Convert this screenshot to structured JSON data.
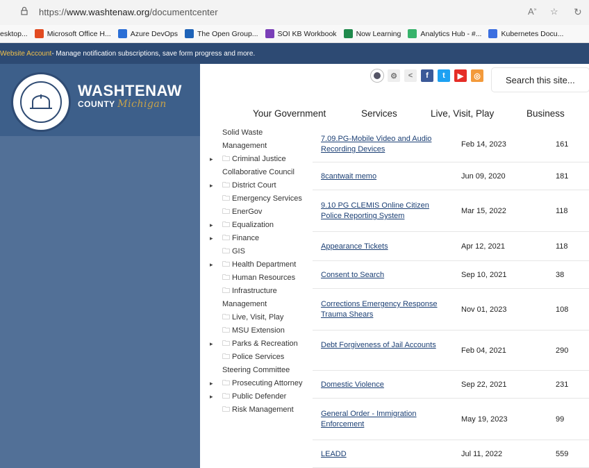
{
  "browser": {
    "url_prefix": "https://",
    "url_host": "www.washtenaw.org",
    "url_path": "/documentcenter",
    "bookmarks": [
      {
        "label": "esktop...",
        "color": "#444"
      },
      {
        "label": "Microsoft Office H...",
        "color": "#e24b21"
      },
      {
        "label": "Azure DevOps",
        "color": "#2b6fd6"
      },
      {
        "label": "The Open Group...",
        "color": "#1e63b8"
      },
      {
        "label": "SOI KB Workbook",
        "color": "#7a3fb8"
      },
      {
        "label": "Now Learning",
        "color": "#1f8a4c"
      },
      {
        "label": "Analytics Hub - #...",
        "color": "#37b36b"
      },
      {
        "label": "Kubernetes Docu...",
        "color": "#3b6fe0"
      }
    ]
  },
  "notice": {
    "link": "Website Account",
    "text": " - Manage notification subscriptions, save form progress and more."
  },
  "brand": {
    "line1": "WASHTENAW",
    "line2_prefix": "COUNTY ",
    "line2_script": "Michigan",
    "seal_label": "WASHTENAW COUNTY MICHIGAN 1826"
  },
  "search": {
    "placeholder": "Search this site..."
  },
  "nav": {
    "your_government": "Your Government",
    "services": "Services",
    "live_visit_play": "Live, Visit, Play",
    "business": "Business"
  },
  "tree": [
    {
      "label": "Solid Waste Management",
      "arrow": false,
      "folder": false
    },
    {
      "label": "Criminal Justice Collaborative Council",
      "arrow": true,
      "folder": true
    },
    {
      "label": "District Court",
      "arrow": true,
      "folder": true
    },
    {
      "label": "Emergency Services",
      "arrow": false,
      "folder": true
    },
    {
      "label": "EnerGov",
      "arrow": false,
      "folder": true
    },
    {
      "label": "Equalization",
      "arrow": true,
      "folder": true
    },
    {
      "label": "Finance",
      "arrow": true,
      "folder": true
    },
    {
      "label": "GIS",
      "arrow": false,
      "folder": true
    },
    {
      "label": "Health Department",
      "arrow": true,
      "folder": true
    },
    {
      "label": "Human Resources",
      "arrow": false,
      "folder": true
    },
    {
      "label": "Infrastructure Management",
      "arrow": false,
      "folder": true
    },
    {
      "label": "Live, Visit, Play",
      "arrow": false,
      "folder": true
    },
    {
      "label": "MSU Extension",
      "arrow": false,
      "folder": true
    },
    {
      "label": "Parks & Recreation",
      "arrow": true,
      "folder": true
    },
    {
      "label": "Police Services Steering Committee",
      "arrow": false,
      "folder": true
    },
    {
      "label": "Prosecuting Attorney",
      "arrow": true,
      "folder": true
    },
    {
      "label": "Public Defender",
      "arrow": true,
      "folder": true
    },
    {
      "label": "Risk Management",
      "arrow": false,
      "folder": true
    }
  ],
  "documents": [
    {
      "name": "7.09.PG-Mobile Video and Audio Recording Devices",
      "date": "Feb 14, 2023",
      "count": "161"
    },
    {
      "name": "8cantwait memo",
      "date": "Jun 09, 2020",
      "count": "181"
    },
    {
      "name": "9.10 PG CLEMIS Online Citizen Police Reporting System",
      "date": "Mar 15, 2022",
      "count": "118"
    },
    {
      "name": "Appearance Tickets",
      "date": "Apr 12, 2021",
      "count": "118"
    },
    {
      "name": "Consent to Search",
      "date": "Sep 10, 2021",
      "count": "38"
    },
    {
      "name": "Corrections Emergency Response Trauma Shears",
      "date": "Nov 01, 2023",
      "count": "108"
    },
    {
      "name": "Debt Forgiveness of Jail Accounts",
      "date": "Feb 04, 2021",
      "count": "290"
    },
    {
      "name": "Domestic Violence",
      "date": "Sep 22, 2021",
      "count": "231"
    },
    {
      "name": "General Order - Immigration Enforcement",
      "date": "May 19, 2023",
      "count": "99"
    },
    {
      "name": "LEADD",
      "date": "Jul 11, 2022",
      "count": "559"
    }
  ],
  "colors": {
    "site_blue": "#2d4a73",
    "panel_blue": "#527097",
    "link": "#1b3f74"
  }
}
